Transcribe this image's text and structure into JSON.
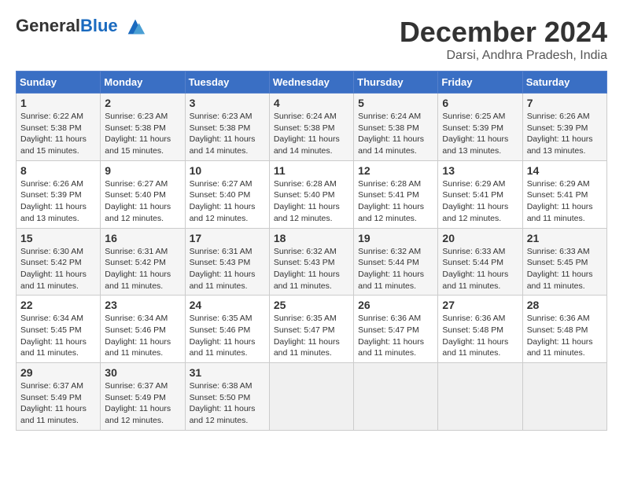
{
  "header": {
    "logo_general": "General",
    "logo_blue": "Blue",
    "month_title": "December 2024",
    "location": "Darsi, Andhra Pradesh, India"
  },
  "days_of_week": [
    "Sunday",
    "Monday",
    "Tuesday",
    "Wednesday",
    "Thursday",
    "Friday",
    "Saturday"
  ],
  "weeks": [
    [
      {
        "day": "1",
        "sunrise": "6:22 AM",
        "sunset": "5:38 PM",
        "daylight": "11 hours and 15 minutes."
      },
      {
        "day": "2",
        "sunrise": "6:23 AM",
        "sunset": "5:38 PM",
        "daylight": "11 hours and 15 minutes."
      },
      {
        "day": "3",
        "sunrise": "6:23 AM",
        "sunset": "5:38 PM",
        "daylight": "11 hours and 14 minutes."
      },
      {
        "day": "4",
        "sunrise": "6:24 AM",
        "sunset": "5:38 PM",
        "daylight": "11 hours and 14 minutes."
      },
      {
        "day": "5",
        "sunrise": "6:24 AM",
        "sunset": "5:38 PM",
        "daylight": "11 hours and 14 minutes."
      },
      {
        "day": "6",
        "sunrise": "6:25 AM",
        "sunset": "5:39 PM",
        "daylight": "11 hours and 13 minutes."
      },
      {
        "day": "7",
        "sunrise": "6:26 AM",
        "sunset": "5:39 PM",
        "daylight": "11 hours and 13 minutes."
      }
    ],
    [
      {
        "day": "8",
        "sunrise": "6:26 AM",
        "sunset": "5:39 PM",
        "daylight": "11 hours and 13 minutes."
      },
      {
        "day": "9",
        "sunrise": "6:27 AM",
        "sunset": "5:40 PM",
        "daylight": "11 hours and 12 minutes."
      },
      {
        "day": "10",
        "sunrise": "6:27 AM",
        "sunset": "5:40 PM",
        "daylight": "11 hours and 12 minutes."
      },
      {
        "day": "11",
        "sunrise": "6:28 AM",
        "sunset": "5:40 PM",
        "daylight": "11 hours and 12 minutes."
      },
      {
        "day": "12",
        "sunrise": "6:28 AM",
        "sunset": "5:41 PM",
        "daylight": "11 hours and 12 minutes."
      },
      {
        "day": "13",
        "sunrise": "6:29 AM",
        "sunset": "5:41 PM",
        "daylight": "11 hours and 12 minutes."
      },
      {
        "day": "14",
        "sunrise": "6:29 AM",
        "sunset": "5:41 PM",
        "daylight": "11 hours and 11 minutes."
      }
    ],
    [
      {
        "day": "15",
        "sunrise": "6:30 AM",
        "sunset": "5:42 PM",
        "daylight": "11 hours and 11 minutes."
      },
      {
        "day": "16",
        "sunrise": "6:31 AM",
        "sunset": "5:42 PM",
        "daylight": "11 hours and 11 minutes."
      },
      {
        "day": "17",
        "sunrise": "6:31 AM",
        "sunset": "5:43 PM",
        "daylight": "11 hours and 11 minutes."
      },
      {
        "day": "18",
        "sunrise": "6:32 AM",
        "sunset": "5:43 PM",
        "daylight": "11 hours and 11 minutes."
      },
      {
        "day": "19",
        "sunrise": "6:32 AM",
        "sunset": "5:44 PM",
        "daylight": "11 hours and 11 minutes."
      },
      {
        "day": "20",
        "sunrise": "6:33 AM",
        "sunset": "5:44 PM",
        "daylight": "11 hours and 11 minutes."
      },
      {
        "day": "21",
        "sunrise": "6:33 AM",
        "sunset": "5:45 PM",
        "daylight": "11 hours and 11 minutes."
      }
    ],
    [
      {
        "day": "22",
        "sunrise": "6:34 AM",
        "sunset": "5:45 PM",
        "daylight": "11 hours and 11 minutes."
      },
      {
        "day": "23",
        "sunrise": "6:34 AM",
        "sunset": "5:46 PM",
        "daylight": "11 hours and 11 minutes."
      },
      {
        "day": "24",
        "sunrise": "6:35 AM",
        "sunset": "5:46 PM",
        "daylight": "11 hours and 11 minutes."
      },
      {
        "day": "25",
        "sunrise": "6:35 AM",
        "sunset": "5:47 PM",
        "daylight": "11 hours and 11 minutes."
      },
      {
        "day": "26",
        "sunrise": "6:36 AM",
        "sunset": "5:47 PM",
        "daylight": "11 hours and 11 minutes."
      },
      {
        "day": "27",
        "sunrise": "6:36 AM",
        "sunset": "5:48 PM",
        "daylight": "11 hours and 11 minutes."
      },
      {
        "day": "28",
        "sunrise": "6:36 AM",
        "sunset": "5:48 PM",
        "daylight": "11 hours and 11 minutes."
      }
    ],
    [
      {
        "day": "29",
        "sunrise": "6:37 AM",
        "sunset": "5:49 PM",
        "daylight": "11 hours and 11 minutes."
      },
      {
        "day": "30",
        "sunrise": "6:37 AM",
        "sunset": "5:49 PM",
        "daylight": "11 hours and 12 minutes."
      },
      {
        "day": "31",
        "sunrise": "6:38 AM",
        "sunset": "5:50 PM",
        "daylight": "11 hours and 12 minutes."
      },
      null,
      null,
      null,
      null
    ]
  ],
  "labels": {
    "sunrise": "Sunrise:",
    "sunset": "Sunset:",
    "daylight": "Daylight:"
  }
}
